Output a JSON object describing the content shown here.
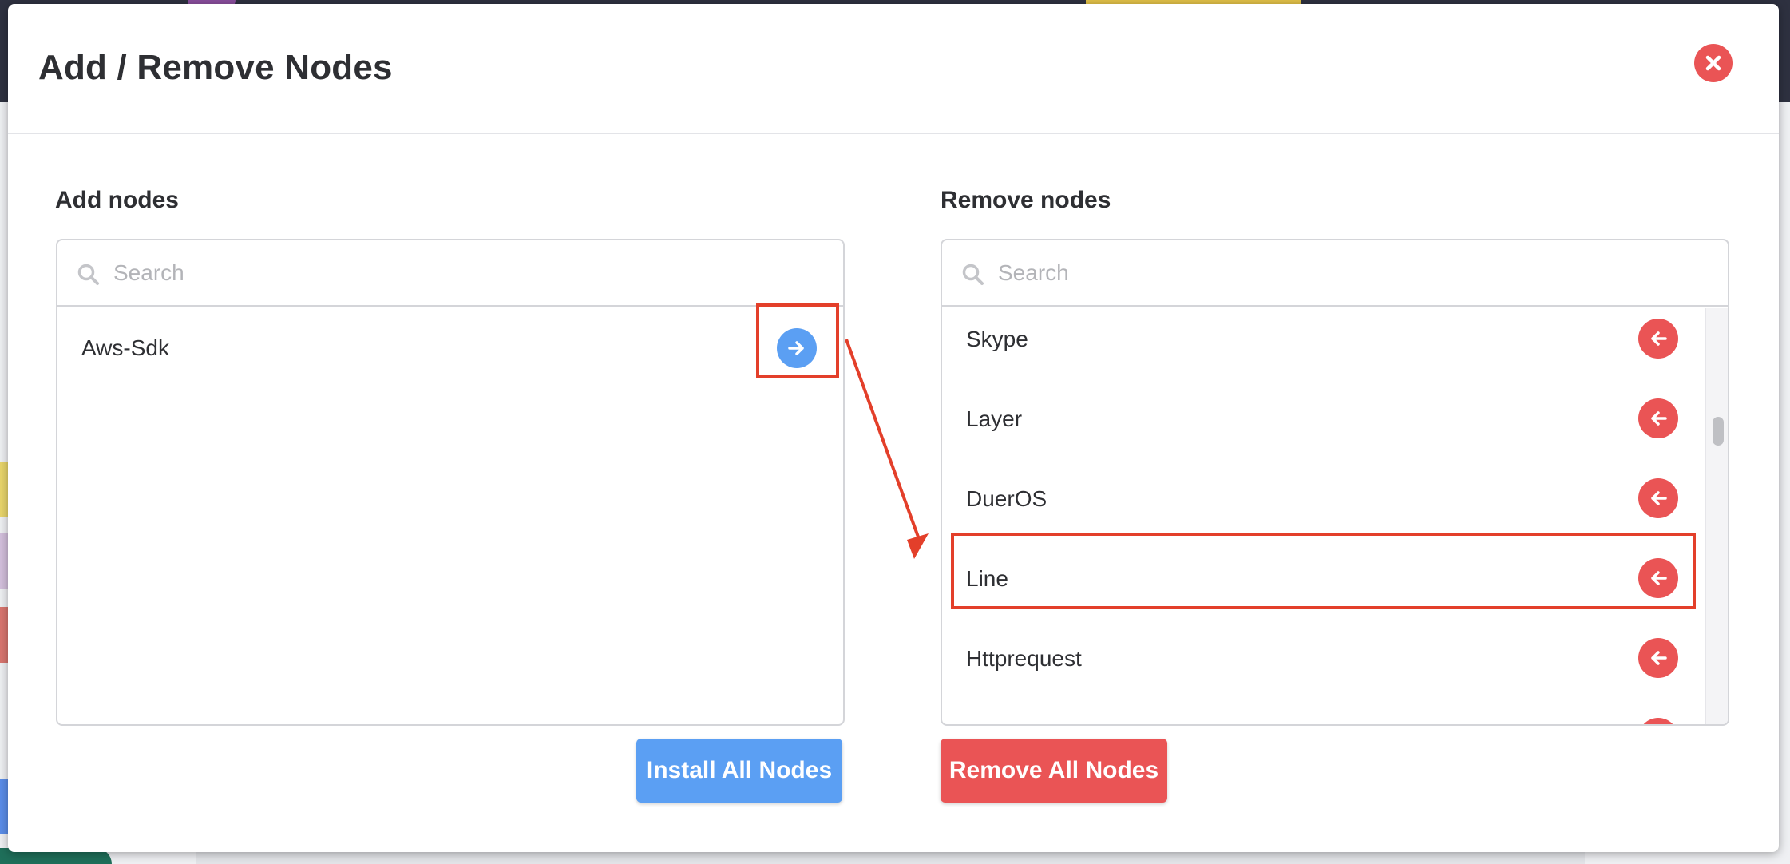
{
  "modal": {
    "title": "Add / Remove Nodes",
    "close_icon": "close-x-icon"
  },
  "add_panel": {
    "label": "Add nodes",
    "search_placeholder": "Search",
    "items": [
      {
        "label": "Aws-Sdk",
        "action_icon": "arrow-right-icon"
      }
    ],
    "action_button": "Install All Nodes"
  },
  "remove_panel": {
    "label": "Remove nodes",
    "search_placeholder": "Search",
    "items": [
      {
        "label": "Skype",
        "action_icon": "arrow-left-icon"
      },
      {
        "label": "Layer",
        "action_icon": "arrow-left-icon"
      },
      {
        "label": "DuerOS",
        "action_icon": "arrow-left-icon"
      },
      {
        "label": "Line",
        "action_icon": "arrow-left-icon"
      },
      {
        "label": "Httprequest",
        "action_icon": "arrow-left-icon"
      }
    ],
    "action_button": "Remove All Nodes"
  },
  "colors": {
    "primary_blue": "#5b9ff3",
    "danger_red": "#ea5455",
    "annotation_red": "#e33f2a"
  }
}
